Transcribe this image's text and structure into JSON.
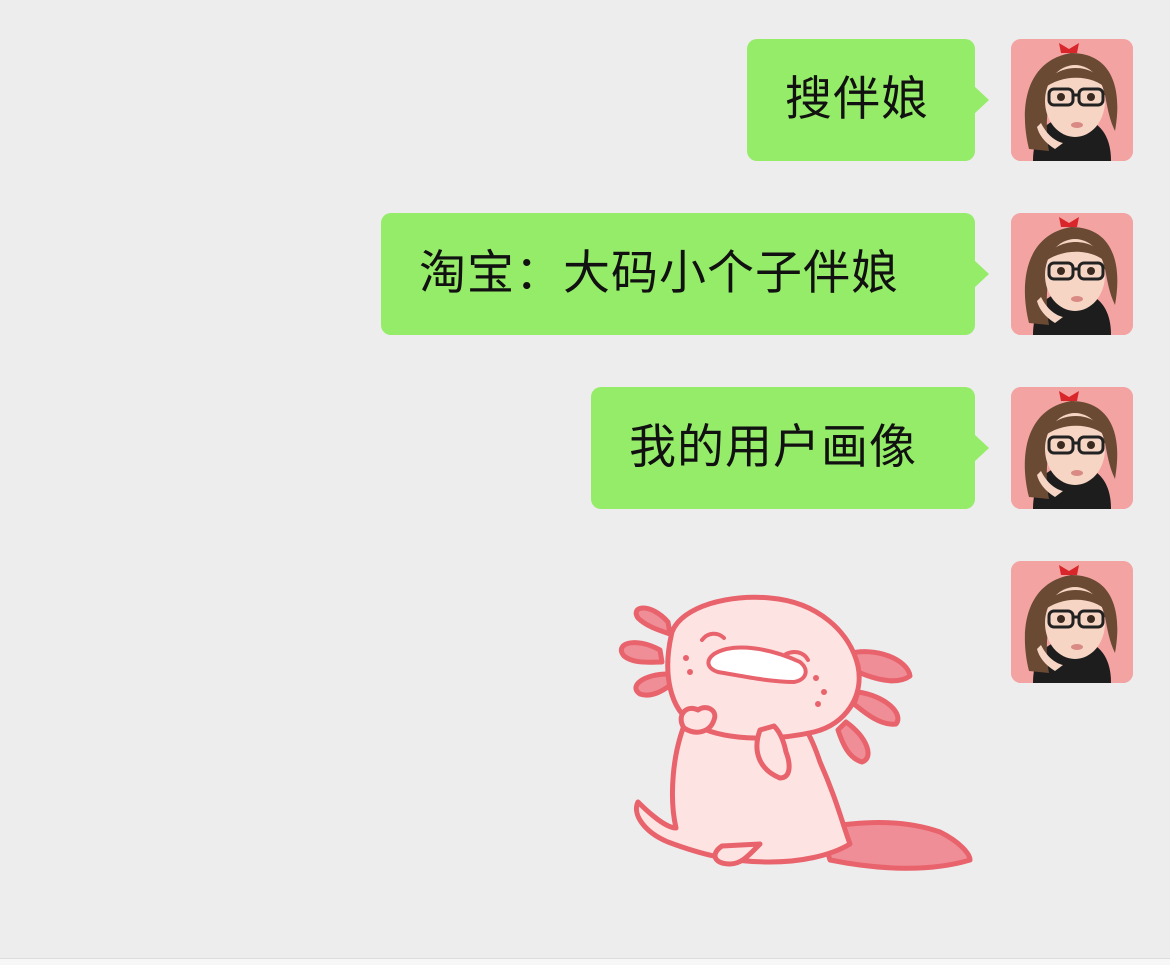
{
  "messages": [
    {
      "text": "搜伴娘",
      "sender": "self"
    },
    {
      "text": "淘宝：大码小个子伴娘",
      "sender": "self"
    },
    {
      "text": "我的用户画像",
      "sender": "self"
    },
    {
      "sticker": "crying-axolotl-sticker",
      "sender": "self"
    }
  ],
  "colors": {
    "background": "#ededed",
    "bubble": "#95ec69",
    "avatar_bg": "#f4a3a3",
    "sticker_body": "#fde3e2",
    "sticker_outline": "#e8636c"
  }
}
